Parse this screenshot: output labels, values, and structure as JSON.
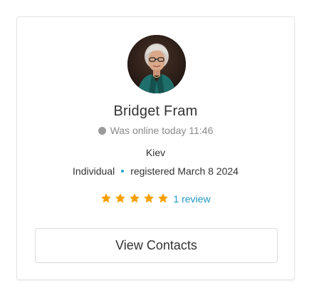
{
  "profile": {
    "name": "Bridget Fram",
    "status_text": "Was online today 11:46",
    "status_color": "#9b9b9b",
    "city": "Kiev",
    "type": "Individual",
    "registered": "registered March 8 2024",
    "rating_stars": 5,
    "rating_max": 5,
    "reviews_link": "1 review",
    "avatar_icon": "user-avatar-photo"
  },
  "actions": {
    "view_contacts_label": "View Contacts"
  },
  "colors": {
    "star": "#f5a000",
    "link": "#2196c4",
    "separator_dot": "#2aa3c6"
  }
}
